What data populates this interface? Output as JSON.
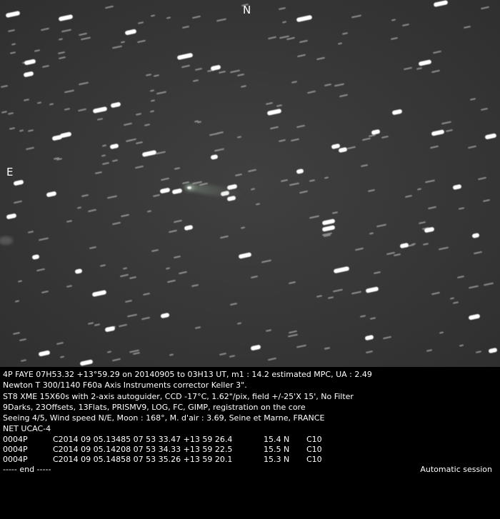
{
  "image": {
    "description_label": "comet field star image",
    "background_color": "#3a3a3a",
    "star_color": "#ffffff"
  },
  "compass": {
    "north": "N",
    "east": "E"
  },
  "caption": {
    "lines": [
      "4P FAYE 07H53.32 +13°59.29 on 20140905 to 03H13 UT, m1 : 14.2 estimated MPC, UA : 2.49",
      "Newton T 300/1140 F60a Axis Instruments corrector Keller 3\".",
      "ST8 XME 15X60s with 2-axis autoguider, CCD -17°C, 1.62\"/pix, field +/-25'X 15', No Filter",
      "9Darks, 23Offsets, 13Flats, PRISMV9, LOG, FC, GIMP, registration on the core",
      "Seeing 4/5, Wind speed N/E, Moon : 168°, M. d'air : 3.69, Seine et Marne, FRANCE",
      "NET UCAC-4"
    ],
    "observations": [
      {
        "id": "0004P",
        "data": "C2014 09 05.13485 07 53 33.47 +13 59 26.4",
        "mag": "15.4 N",
        "code": "C10"
      },
      {
        "id": "0004P",
        "data": "C2014 09 05.14208 07 53 34.33 +13 59 22.5",
        "mag": "15.5 N",
        "code": "C10"
      },
      {
        "id": "0004P",
        "data": "C2014 09 05.14858 07 53 35.26 +13 59 20.1",
        "mag": "15.3 N",
        "code": "C10"
      }
    ],
    "end_text": "----- end -----",
    "session_text": "Automatic session"
  }
}
